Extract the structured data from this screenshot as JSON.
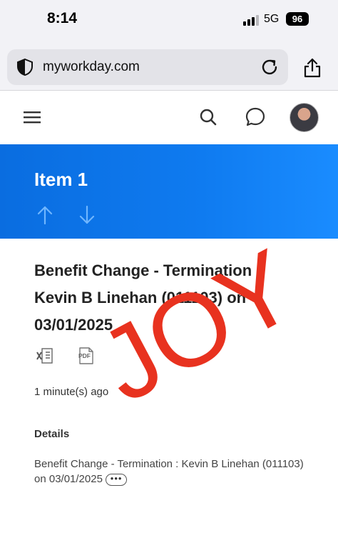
{
  "status_bar": {
    "time": "8:14",
    "network": "5G",
    "battery": "96"
  },
  "browser": {
    "url": "myworkday.com"
  },
  "banner": {
    "title": "Item 1"
  },
  "item": {
    "heading": "Benefit Change - Termination : Kevin B Linehan (011103) on 03/01/2025",
    "time_ago": "1 minute(s) ago",
    "details_label": "Details",
    "details_text": "Benefit Change - Termination : Kevin B Linehan (011103) on 03/01/2025",
    "more_label": "•••",
    "export_pdf_label": "PDF"
  },
  "watermark": {
    "text": "JOY",
    "color": "#e8321f"
  },
  "colors": {
    "banner_blue": "#0a6de0",
    "arrow_light": "#6fb6ff"
  },
  "icons": [
    "shield-icon",
    "reload-icon",
    "share-icon",
    "menu-icon",
    "search-icon",
    "chat-icon",
    "arrow-up-icon",
    "arrow-down-icon",
    "excel-export-icon",
    "pdf-export-icon"
  ]
}
